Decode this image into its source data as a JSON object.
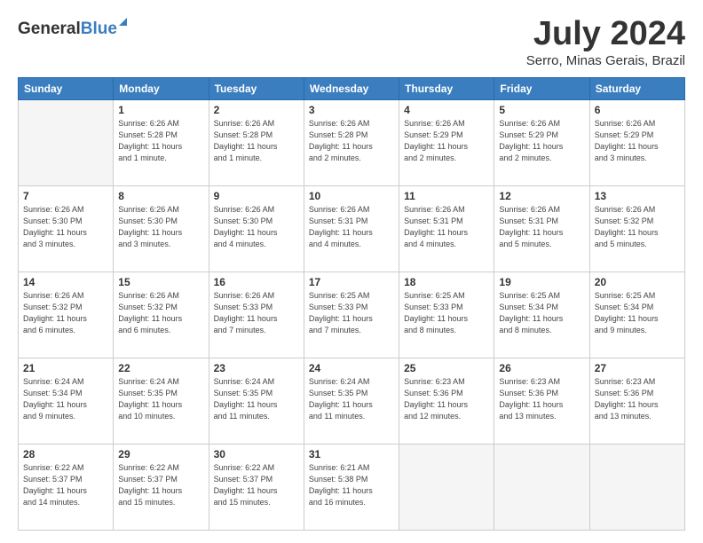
{
  "header": {
    "logo_general": "General",
    "logo_blue": "Blue",
    "month_title": "July 2024",
    "location": "Serro, Minas Gerais, Brazil"
  },
  "calendar": {
    "headers": [
      "Sunday",
      "Monday",
      "Tuesday",
      "Wednesday",
      "Thursday",
      "Friday",
      "Saturday"
    ],
    "weeks": [
      [
        {
          "day": "",
          "info": ""
        },
        {
          "day": "1",
          "info": "Sunrise: 6:26 AM\nSunset: 5:28 PM\nDaylight: 11 hours\nand 1 minute."
        },
        {
          "day": "2",
          "info": "Sunrise: 6:26 AM\nSunset: 5:28 PM\nDaylight: 11 hours\nand 1 minute."
        },
        {
          "day": "3",
          "info": "Sunrise: 6:26 AM\nSunset: 5:28 PM\nDaylight: 11 hours\nand 2 minutes."
        },
        {
          "day": "4",
          "info": "Sunrise: 6:26 AM\nSunset: 5:29 PM\nDaylight: 11 hours\nand 2 minutes."
        },
        {
          "day": "5",
          "info": "Sunrise: 6:26 AM\nSunset: 5:29 PM\nDaylight: 11 hours\nand 2 minutes."
        },
        {
          "day": "6",
          "info": "Sunrise: 6:26 AM\nSunset: 5:29 PM\nDaylight: 11 hours\nand 3 minutes."
        }
      ],
      [
        {
          "day": "7",
          "info": "Sunrise: 6:26 AM\nSunset: 5:30 PM\nDaylight: 11 hours\nand 3 minutes."
        },
        {
          "day": "8",
          "info": "Sunrise: 6:26 AM\nSunset: 5:30 PM\nDaylight: 11 hours\nand 3 minutes."
        },
        {
          "day": "9",
          "info": "Sunrise: 6:26 AM\nSunset: 5:30 PM\nDaylight: 11 hours\nand 4 minutes."
        },
        {
          "day": "10",
          "info": "Sunrise: 6:26 AM\nSunset: 5:31 PM\nDaylight: 11 hours\nand 4 minutes."
        },
        {
          "day": "11",
          "info": "Sunrise: 6:26 AM\nSunset: 5:31 PM\nDaylight: 11 hours\nand 4 minutes."
        },
        {
          "day": "12",
          "info": "Sunrise: 6:26 AM\nSunset: 5:31 PM\nDaylight: 11 hours\nand 5 minutes."
        },
        {
          "day": "13",
          "info": "Sunrise: 6:26 AM\nSunset: 5:32 PM\nDaylight: 11 hours\nand 5 minutes."
        }
      ],
      [
        {
          "day": "14",
          "info": "Sunrise: 6:26 AM\nSunset: 5:32 PM\nDaylight: 11 hours\nand 6 minutes."
        },
        {
          "day": "15",
          "info": "Sunrise: 6:26 AM\nSunset: 5:32 PM\nDaylight: 11 hours\nand 6 minutes."
        },
        {
          "day": "16",
          "info": "Sunrise: 6:26 AM\nSunset: 5:33 PM\nDaylight: 11 hours\nand 7 minutes."
        },
        {
          "day": "17",
          "info": "Sunrise: 6:25 AM\nSunset: 5:33 PM\nDaylight: 11 hours\nand 7 minutes."
        },
        {
          "day": "18",
          "info": "Sunrise: 6:25 AM\nSunset: 5:33 PM\nDaylight: 11 hours\nand 8 minutes."
        },
        {
          "day": "19",
          "info": "Sunrise: 6:25 AM\nSunset: 5:34 PM\nDaylight: 11 hours\nand 8 minutes."
        },
        {
          "day": "20",
          "info": "Sunrise: 6:25 AM\nSunset: 5:34 PM\nDaylight: 11 hours\nand 9 minutes."
        }
      ],
      [
        {
          "day": "21",
          "info": "Sunrise: 6:24 AM\nSunset: 5:34 PM\nDaylight: 11 hours\nand 9 minutes."
        },
        {
          "day": "22",
          "info": "Sunrise: 6:24 AM\nSunset: 5:35 PM\nDaylight: 11 hours\nand 10 minutes."
        },
        {
          "day": "23",
          "info": "Sunrise: 6:24 AM\nSunset: 5:35 PM\nDaylight: 11 hours\nand 11 minutes."
        },
        {
          "day": "24",
          "info": "Sunrise: 6:24 AM\nSunset: 5:35 PM\nDaylight: 11 hours\nand 11 minutes."
        },
        {
          "day": "25",
          "info": "Sunrise: 6:23 AM\nSunset: 5:36 PM\nDaylight: 11 hours\nand 12 minutes."
        },
        {
          "day": "26",
          "info": "Sunrise: 6:23 AM\nSunset: 5:36 PM\nDaylight: 11 hours\nand 13 minutes."
        },
        {
          "day": "27",
          "info": "Sunrise: 6:23 AM\nSunset: 5:36 PM\nDaylight: 11 hours\nand 13 minutes."
        }
      ],
      [
        {
          "day": "28",
          "info": "Sunrise: 6:22 AM\nSunset: 5:37 PM\nDaylight: 11 hours\nand 14 minutes."
        },
        {
          "day": "29",
          "info": "Sunrise: 6:22 AM\nSunset: 5:37 PM\nDaylight: 11 hours\nand 15 minutes."
        },
        {
          "day": "30",
          "info": "Sunrise: 6:22 AM\nSunset: 5:37 PM\nDaylight: 11 hours\nand 15 minutes."
        },
        {
          "day": "31",
          "info": "Sunrise: 6:21 AM\nSunset: 5:38 PM\nDaylight: 11 hours\nand 16 minutes."
        },
        {
          "day": "",
          "info": ""
        },
        {
          "day": "",
          "info": ""
        },
        {
          "day": "",
          "info": ""
        }
      ]
    ]
  }
}
